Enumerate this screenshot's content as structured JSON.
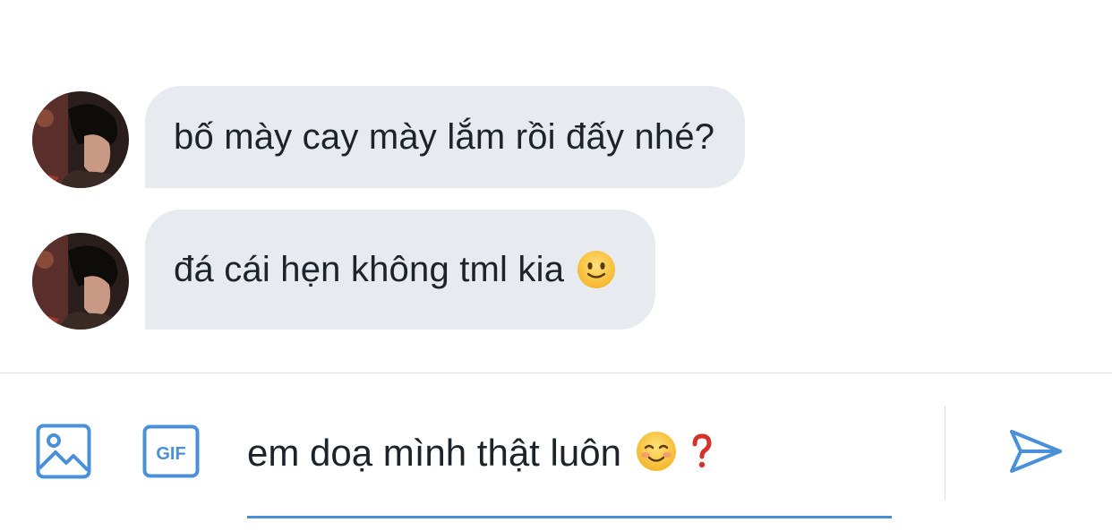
{
  "messages": [
    {
      "text": "bố mày cay mày lắm rồi đấy nhé?",
      "emoji": ""
    },
    {
      "text": "đá cái hẹn không tml kia",
      "emoji": "slightly-smiling-face"
    }
  ],
  "composer": {
    "input_value": "em doạ mình thật luôn",
    "input_emojis": [
      "smiling-face",
      "red-question-mark"
    ],
    "image_icon": "image-icon",
    "gif_label": "GIF",
    "send_icon": "send-icon"
  },
  "colors": {
    "bubble_bg": "#e7eaee",
    "accent": "#4a90d9",
    "divider": "#d9dde1",
    "text": "#1d232a"
  }
}
